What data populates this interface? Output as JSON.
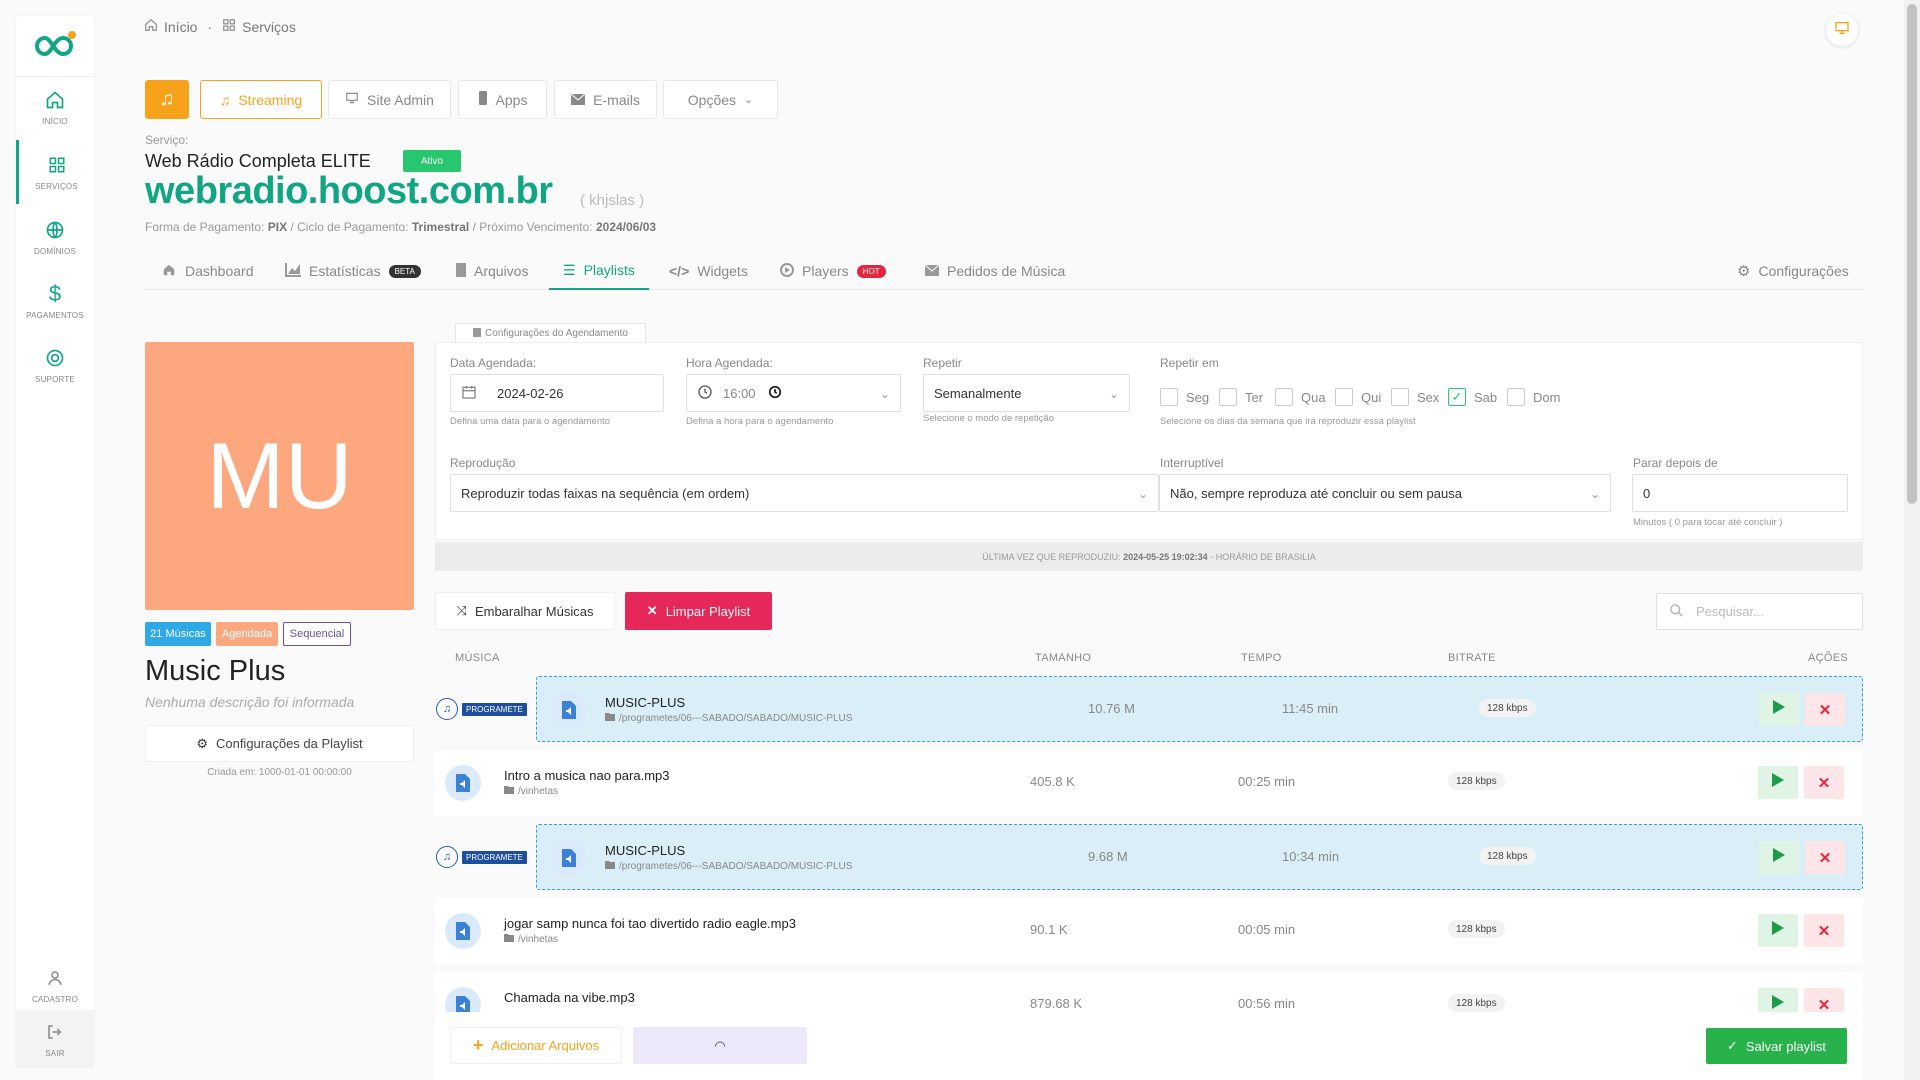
{
  "sidebar": {
    "items": [
      {
        "label": "INÍCIO",
        "icon": "home-icon"
      },
      {
        "label": "SERVIÇOS",
        "icon": "grid-icon"
      },
      {
        "label": "DOMÍNIOS",
        "icon": "globe-icon"
      },
      {
        "label": "PAGAMENTOS",
        "icon": "dollar-icon"
      },
      {
        "label": "SUPORTE",
        "icon": "lifebuoy-icon"
      }
    ],
    "bottom": [
      {
        "label": "CADASTRO",
        "icon": "user-icon"
      },
      {
        "label": "SAIR",
        "icon": "logout-icon"
      }
    ]
  },
  "breadcrumb": {
    "home": "Início",
    "separator": "·",
    "current": "Serviços"
  },
  "topbar": {
    "streaming": "Streaming",
    "site_admin": "Site Admin",
    "apps": "Apps",
    "emails": "E-mails",
    "opcoes": "Opções"
  },
  "service": {
    "label": "Serviço:",
    "name": "Web Rádio Completa ELITE",
    "status": "Ativo",
    "domain": "webradio.hoost.com.br",
    "domain_sub": "( khjslas )",
    "pay_label": "Forma de Pagamento:",
    "pay_value": "PIX",
    "cycle_label": "/ Ciclo de Pagamento:",
    "cycle_value": "Trimestral",
    "due_label": "/ Próximo Vencimento:",
    "due_value": "2024/06/03"
  },
  "tabs": {
    "dashboard": "Dashboard",
    "estatisticas": "Estatísticas",
    "beta": "BETA",
    "arquivos": "Arquivos",
    "playlists": "Playlists",
    "widgets": "Widgets",
    "players": "Players",
    "hot": "HOT",
    "pedidos": "Pedidos de Música",
    "configuracoes": "Configurações"
  },
  "playlist": {
    "cover_initials": "MU",
    "tag_count": "21 Músicas",
    "tag_scheduled": "Agendada",
    "tag_sequential": "Sequencial",
    "name": "Music Plus",
    "description": "Nenhuma descrição foi informada",
    "config_button": "Configurações da Playlist",
    "created": "Criada em: 1000-01-01 00:00:00"
  },
  "schedule": {
    "tab_label": "Configurações do Agendamento",
    "date_label": "Data Agendada:",
    "date_value": "2024-02-26",
    "date_help": "Defina uma data para o agendamento",
    "time_label": "Hora Agendada:",
    "time_value": "16:00",
    "time_help": "Defina a hora para o agendamento",
    "repeat_label": "Repetir",
    "repeat_value": "Semanalmente",
    "repeat_help": "Selecione o modo de repetição",
    "repeat_on_label": "Repetir em",
    "repeat_on_help": "Selecione os dias da semana que irá reproduzir essa playlist",
    "days": [
      {
        "label": "Seg",
        "checked": false
      },
      {
        "label": "Ter",
        "checked": false
      },
      {
        "label": "Qua",
        "checked": false
      },
      {
        "label": "Qui",
        "checked": false
      },
      {
        "label": "Sex",
        "checked": false
      },
      {
        "label": "Sab",
        "checked": true
      },
      {
        "label": "Dom",
        "checked": false
      }
    ],
    "playback_label": "Reprodução",
    "playback_value": "Reproduzir todas faixas na sequência (em ordem)",
    "interrupt_label": "Interruptível",
    "interrupt_value": "Não, sempre reproduza até concluir ou sem pausa",
    "stop_label": "Parar depois de",
    "stop_value": "0",
    "stop_help": "Minutos ( 0 para tocar até concluir )",
    "last_played_prefix": "ÚLTIMA VEZ QUE REPRODUZIU:",
    "last_played_value": "2024-05-25 19:02:34",
    "last_played_suffix": "- HORÁRIO DE BRASILIA"
  },
  "actions": {
    "shuffle": "Embaralhar Músicas",
    "clear": "Limpar Playlist",
    "search_placeholder": "Pesquisar..."
  },
  "table": {
    "headers": {
      "music": "MÚSICA",
      "size": "TAMANHO",
      "time": "TEMPO",
      "bitrate": "BITRATE",
      "actions": "AÇÕES"
    },
    "program_tag": "PROGRAMETE",
    "rows": [
      {
        "name": "MUSIC-PLUS",
        "path": "/programetes/06---SABADO/SABADO/MUSIC-PLUS",
        "size": "10.76 M",
        "time": "11:45 min",
        "bitrate": "128 kbps",
        "programete": true
      },
      {
        "name": "Intro a musica nao para.mp3",
        "path": "/vinhetas",
        "size": "405.8 K",
        "time": "00:25 min",
        "bitrate": "128 kbps",
        "programete": false
      },
      {
        "name": "MUSIC-PLUS",
        "path": "/programetes/06---SABADO/SABADO/MUSIC-PLUS",
        "size": "9.68 M",
        "time": "10:34 min",
        "bitrate": "128 kbps",
        "programete": true
      },
      {
        "name": "jogar samp nunca foi tao divertido radio eagle.mp3",
        "path": "/vinhetas",
        "size": "90.1 K",
        "time": "00:05 min",
        "bitrate": "128 kbps",
        "programete": false
      },
      {
        "name": "Chamada na vibe.mp3",
        "path": "",
        "size": "879.68 K",
        "time": "00:56 min",
        "bitrate": "128 kbps",
        "programete": false
      }
    ]
  },
  "footer": {
    "add_files": "Adicionar Arquivos",
    "save": "Salvar playlist"
  },
  "colors": {
    "accent": "#11a683",
    "orange": "#f7a21b",
    "danger": "#e5273e",
    "success": "#28c76f",
    "cover": "#fda77f"
  }
}
